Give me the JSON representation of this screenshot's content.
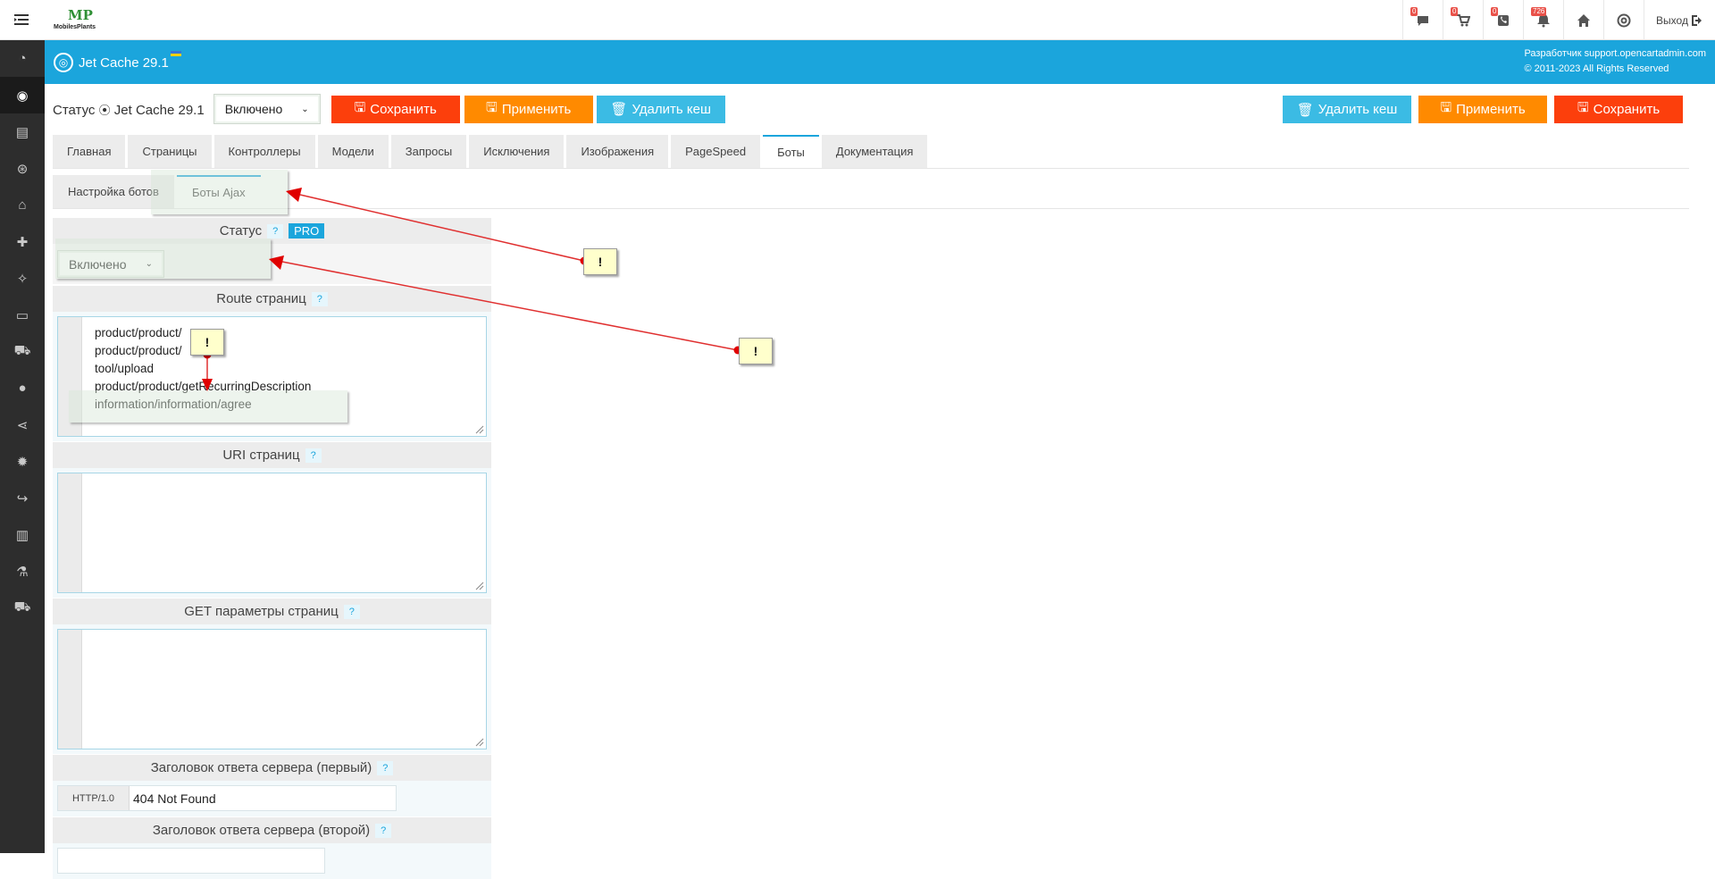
{
  "topbar": {
    "brand": "MobilesPlants",
    "notifications": [
      {
        "icon": "comment-icon",
        "badge": "0"
      },
      {
        "icon": "cart-icon",
        "badge": "0"
      },
      {
        "icon": "phone-icon",
        "badge": "0"
      },
      {
        "icon": "bell-icon",
        "badge": "726"
      }
    ],
    "home_icon": "home-icon",
    "help_icon": "life-ring-icon",
    "logout_label": "Выход"
  },
  "sidebar": {
    "icons": [
      "dashboard-icon",
      "target-icon",
      "catalog-icon",
      "module-icon",
      "tag-icon",
      "puzzle-icon",
      "bulb-icon",
      "monitor-icon",
      "cart-icon",
      "user-icon",
      "share-icon",
      "gear-icon",
      "redo-icon",
      "chart-icon",
      "flask-icon",
      "shop-icon"
    ],
    "active_index": 1
  },
  "header": {
    "title": "Jet Cache 29.1",
    "developer_line": "Разработчик support.opencartadmin.com",
    "copyright": "© 2011-2023 All Rights Reserved",
    "bg_color": "#1ba5dc"
  },
  "status_row": {
    "label": "Статус",
    "module_name": "Jet Cache 29.1",
    "status_value": "Включено"
  },
  "actions": {
    "save": "Сохранить",
    "apply": "Применить",
    "delete_cache": "Удалить кеш"
  },
  "tabs": [
    "Главная",
    "Страницы",
    "Контроллеры",
    "Модели",
    "Запросы",
    "Исключения",
    "Изображения",
    "PageSpeed",
    "Боты",
    "Документация"
  ],
  "active_tab": "Боты",
  "subtabs": [
    "Настройка ботов",
    "Боты Ajax"
  ],
  "active_subtab": "Боты Ajax",
  "form": {
    "status": {
      "label": "Статус",
      "help": "?",
      "badge": "PRO",
      "value": "Включено"
    },
    "route": {
      "label": "Route страниц",
      "help": "?",
      "lines": [
        "product/product/",
        "product/product/",
        "tool/upload",
        "product/product/getRecurringDescription",
        "information/information/agree"
      ]
    },
    "uri": {
      "label": "URI страниц",
      "help": "?",
      "value": ""
    },
    "get_params": {
      "label": "GET параметры страниц",
      "help": "?",
      "value": ""
    },
    "header_first": {
      "label": "Заголовок ответа сервера (первый)",
      "help": "?",
      "prefix": "HTTP/1.0",
      "value": "404 Not Found"
    },
    "header_second": {
      "label": "Заголовок ответа сервера (второй)",
      "help": "?"
    }
  },
  "annotations": {
    "marker": "!"
  }
}
